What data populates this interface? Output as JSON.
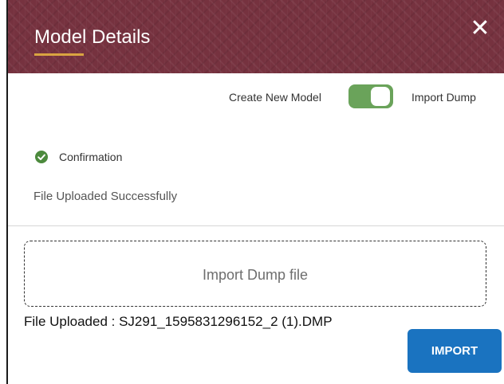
{
  "dialog": {
    "title": "Model Details",
    "close_symbol": "✕",
    "header_color": "#76323f",
    "underline_color": "#d9a441"
  },
  "toggle": {
    "left_label": "Create New Model",
    "right_label": "Import Dump",
    "state": "on",
    "on_color": "#6aa35a"
  },
  "confirmation": {
    "icon": "check-circle-icon",
    "label": "Confirmation",
    "message": "File Uploaded Successfully",
    "icon_color": "#4c8a3d"
  },
  "dropzone": {
    "label": "Import Dump file"
  },
  "file_uploaded": "File Uploaded : SJ291_1595831296152_2 (1).DMP",
  "import_button": {
    "label": "IMPORT",
    "color": "#1a73c0"
  }
}
